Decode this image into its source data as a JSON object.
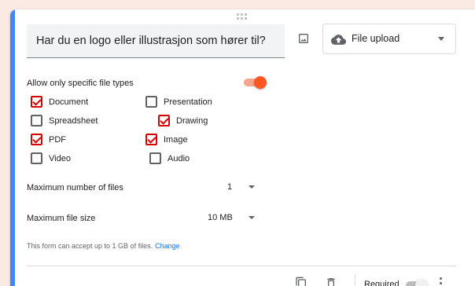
{
  "question": {
    "title": "Har du en logo eller illustrasjon som hører til?"
  },
  "question_type": {
    "selected": "File upload",
    "icon": "cloud-upload-icon"
  },
  "file_types": {
    "label": "Allow only specific file types",
    "enabled": true,
    "options": [
      {
        "label": "Document",
        "checked": true
      },
      {
        "label": "Presentation",
        "checked": false
      },
      {
        "label": "Spreadsheet",
        "checked": false
      },
      {
        "label": "Drawing",
        "checked": true
      },
      {
        "label": "PDF",
        "checked": true
      },
      {
        "label": "Image",
        "checked": true
      },
      {
        "label": "Video",
        "checked": false
      },
      {
        "label": "Audio",
        "checked": false
      }
    ]
  },
  "max_files": {
    "label": "Maximum number of files",
    "value": "1"
  },
  "max_size": {
    "label": "Maximum file size",
    "value": "10 MB"
  },
  "note": {
    "text": "This form can accept up to 1 GB of files.",
    "link": "Change"
  },
  "footer": {
    "required_label": "Required",
    "required_enabled": false
  },
  "colors": {
    "accent": "#4285f4",
    "toggle_on": "#ff5722",
    "checkbox_checked": "#d50000",
    "link": "#1a73e8",
    "background": "#fbe9e3"
  }
}
